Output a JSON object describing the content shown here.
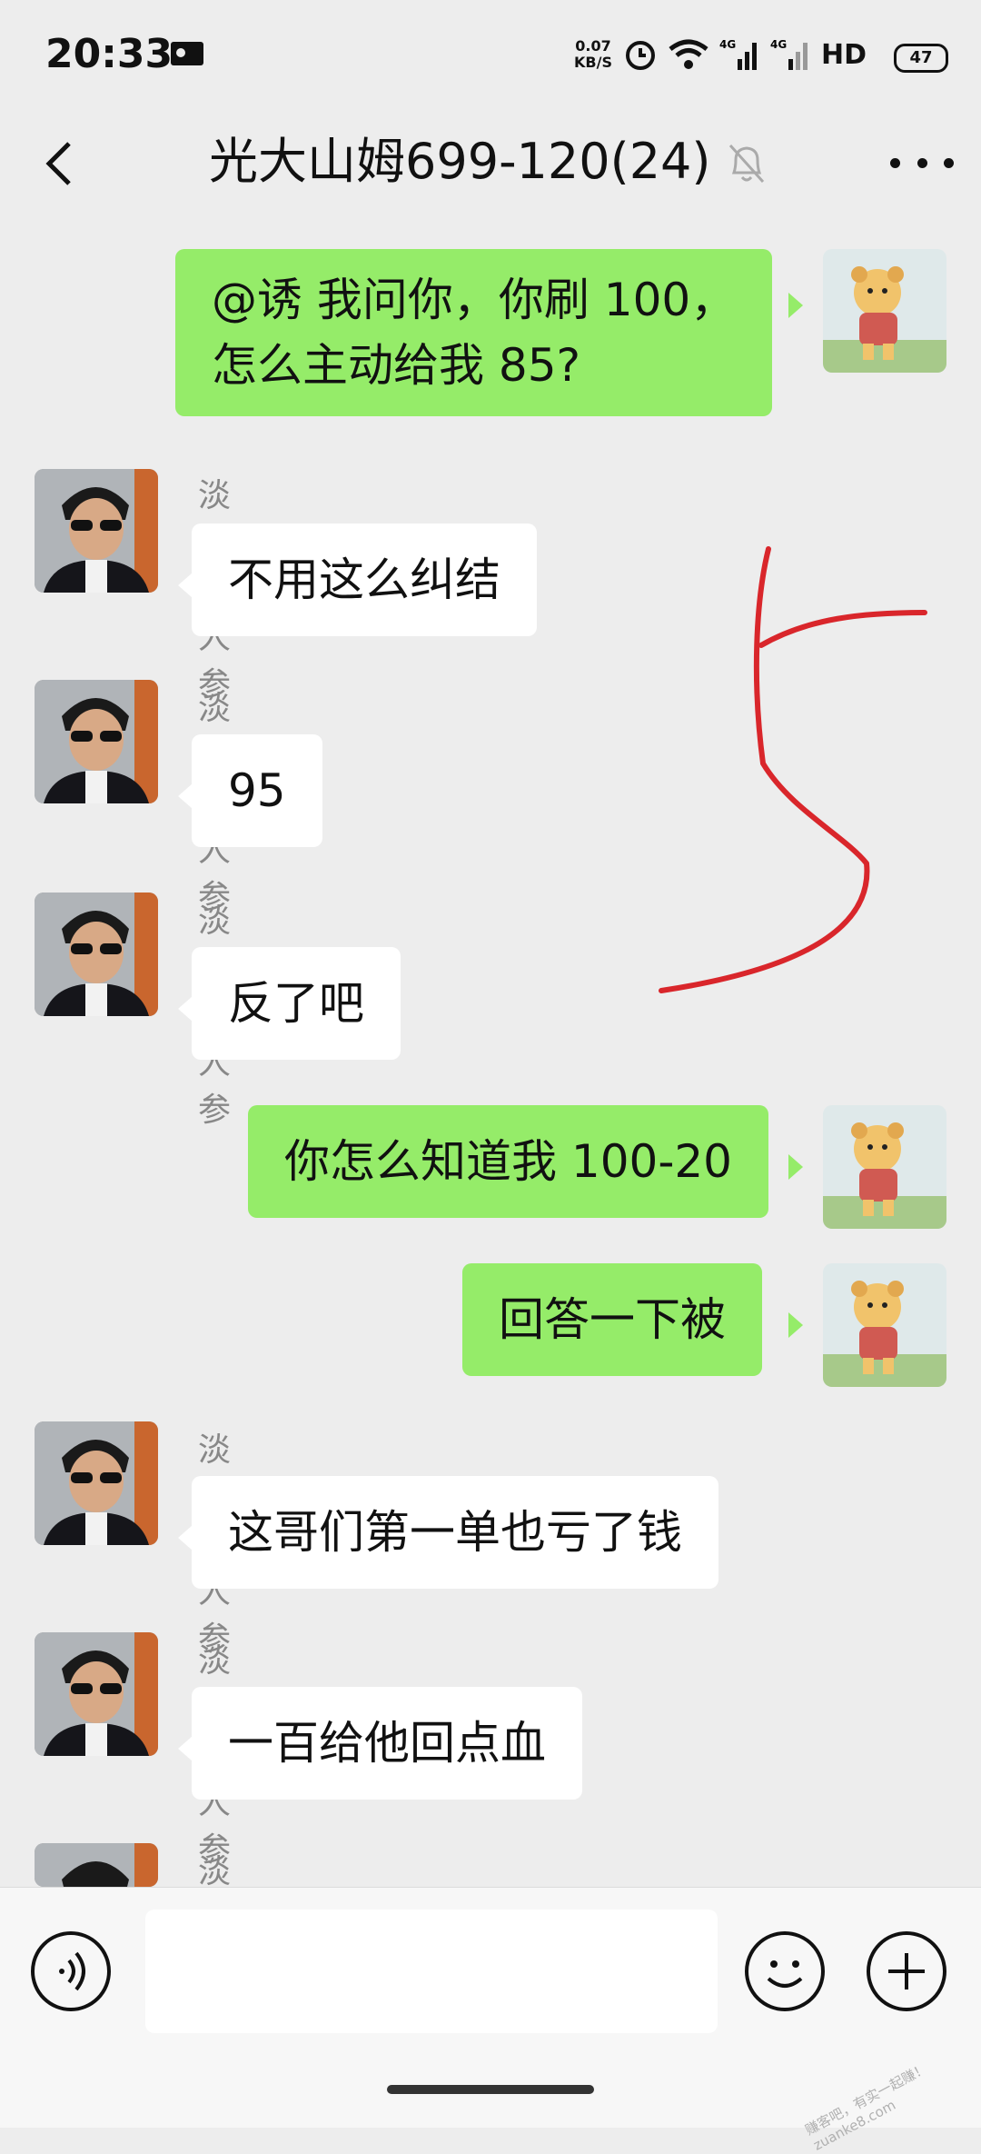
{
  "status_bar": {
    "time": "20:33",
    "net_speed_value": "0.07",
    "net_speed_unit": "KB/S",
    "signal_label": "4G",
    "hd_label": "HD",
    "battery": "47"
  },
  "header": {
    "title": "光大山姆699-120(24)"
  },
  "messages": [
    {
      "side": "me",
      "text_line1": "@诱  我问你，你刷 100，",
      "text_line2": "怎么主动给我 85?"
    },
    {
      "side": "other",
      "sender": "淡定的人参",
      "text": "不用这么纠结"
    },
    {
      "side": "other",
      "sender": "淡定的人参",
      "text": "95"
    },
    {
      "side": "other",
      "sender": "淡定的人参",
      "text": "反了吧"
    },
    {
      "side": "me",
      "text": "你怎么知道我 100-20"
    },
    {
      "side": "me",
      "text": "回答一下被"
    },
    {
      "side": "other",
      "sender": "淡定的人参",
      "text": "这哥们第一单也亏了钱"
    },
    {
      "side": "other",
      "sender": "淡定的人参",
      "text": "一百给他回点血"
    },
    {
      "side": "other",
      "sender": "淡定的人参"
    }
  ],
  "annotation": {
    "color": "#d9262b"
  },
  "colors": {
    "my_bubble": "#95ec69",
    "other_bubble": "#ffffff",
    "background": "#ededed"
  },
  "watermark": "赚客吧，有实一起赚！ zuanke8.com"
}
